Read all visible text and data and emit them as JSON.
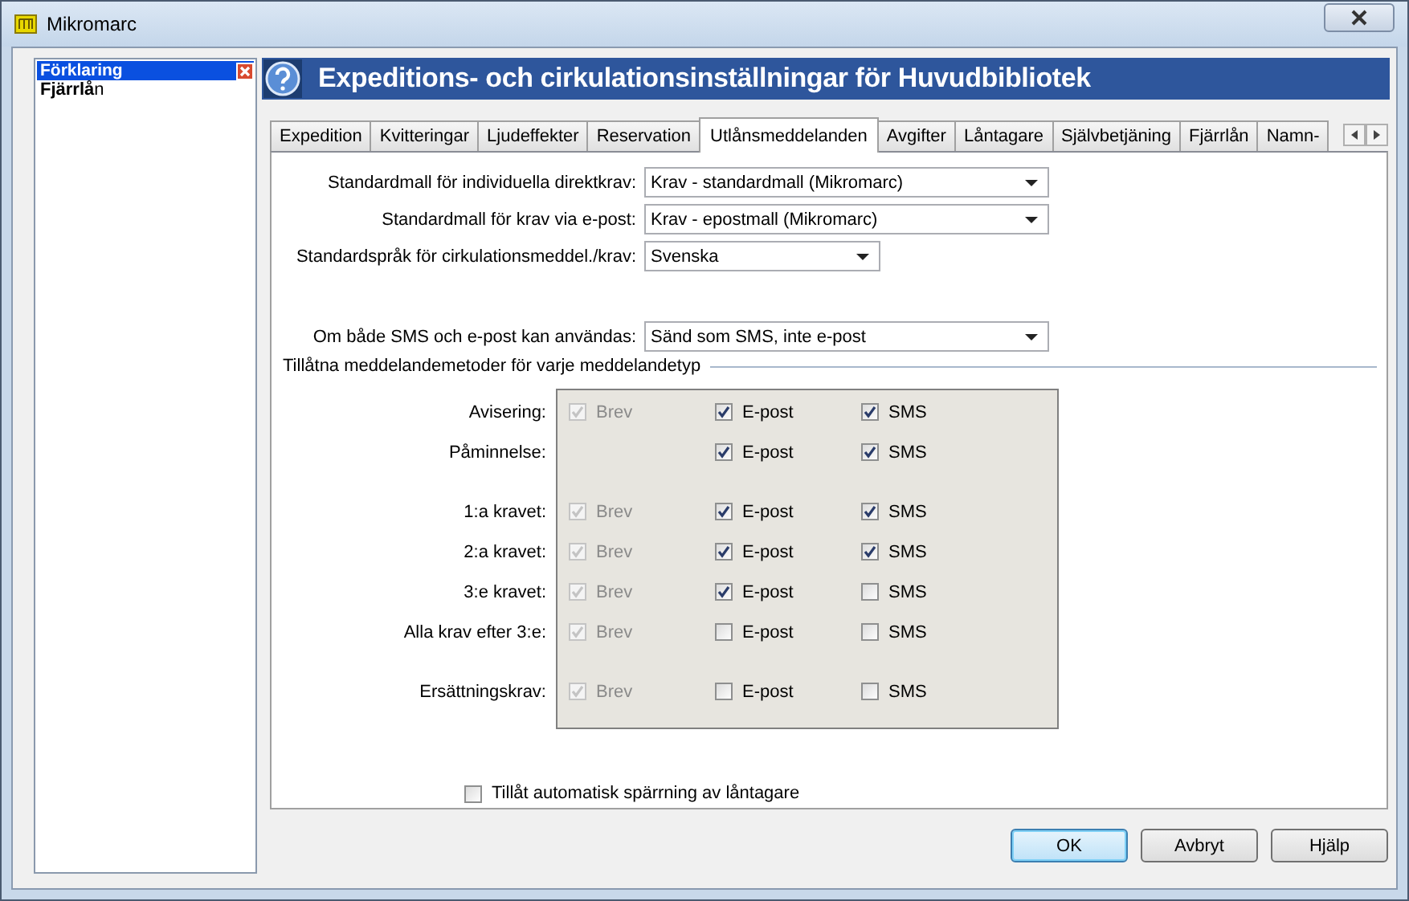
{
  "window": {
    "title": "Mikromarc"
  },
  "side_panel": {
    "title": "Förklaring",
    "items": [
      "**Fjärrlå**n"
    ]
  },
  "header": {
    "title": "Expeditions- och cirkulationsinställningar för Huvudbibliotek"
  },
  "tabs": [
    {
      "label": "Expedition",
      "selected": false
    },
    {
      "label": "Kvitteringar",
      "selected": false
    },
    {
      "label": "Ljudeffekter",
      "selected": false
    },
    {
      "label": "Reservation",
      "selected": false
    },
    {
      "label": "Utlånsmeddelanden",
      "selected": true
    },
    {
      "label": "Avgifter",
      "selected": false
    },
    {
      "label": "Låntagare",
      "selected": false
    },
    {
      "label": "Självbetjäning",
      "selected": false
    },
    {
      "label": "Fjärrlån",
      "selected": false
    },
    {
      "label": "Namn-",
      "selected": false
    }
  ],
  "selects": [
    {
      "label": "Standardmall för individuella direktkrav:",
      "value": "Krav - standardmall (Mikromarc)",
      "kind": "wide"
    },
    {
      "label": "Standardmall för krav via e-post:",
      "value": "Krav - epostmall (Mikromarc)",
      "kind": "wide"
    },
    {
      "label": "Standardspråk för cirkulationsmeddel./krav:",
      "value": "Svenska",
      "kind": "narrow"
    },
    {
      "label": "Om både SMS och e-post kan användas:",
      "value": "Sänd som SMS, inte e-post",
      "kind": "wide",
      "spaced": true
    }
  ],
  "methods_section": {
    "title": "Tillåtna meddelandemetoder för varje meddelandetyp",
    "groups": [
      {
        "rows": [
          {
            "label": "Avisering:",
            "brev": {
              "label": "Brev",
              "checked": true,
              "disabled": true
            },
            "epost": {
              "label": "E-post",
              "checked": true,
              "disabled": false
            },
            "sms": {
              "label": "SMS",
              "checked": true,
              "disabled": false
            }
          },
          {
            "label": "Påminnelse:",
            "epost": {
              "label": "E-post",
              "checked": true,
              "disabled": false
            },
            "sms": {
              "label": "SMS",
              "checked": true,
              "disabled": false
            }
          }
        ]
      },
      {
        "rows": [
          {
            "label": "1:a kravet:",
            "brev": {
              "label": "Brev",
              "checked": true,
              "disabled": true
            },
            "epost": {
              "label": "E-post",
              "checked": true,
              "disabled": false
            },
            "sms": {
              "label": "SMS",
              "checked": true,
              "disabled": false
            }
          },
          {
            "label": "2:a kravet:",
            "brev": {
              "label": "Brev",
              "checked": true,
              "disabled": true
            },
            "epost": {
              "label": "E-post",
              "checked": true,
              "disabled": false
            },
            "sms": {
              "label": "SMS",
              "checked": true,
              "disabled": false
            }
          },
          {
            "label": "3:e kravet:",
            "brev": {
              "label": "Brev",
              "checked": true,
              "disabled": true
            },
            "epost": {
              "label": "E-post",
              "checked": true,
              "disabled": false
            },
            "sms": {
              "label": "SMS",
              "checked": false,
              "disabled": false
            }
          },
          {
            "label": "Alla krav efter 3:e:",
            "brev": {
              "label": "Brev",
              "checked": true,
              "disabled": true
            },
            "epost": {
              "label": "E-post",
              "checked": false,
              "disabled": false
            },
            "sms": {
              "label": "SMS",
              "checked": false,
              "disabled": false
            }
          }
        ]
      },
      {
        "rows": [
          {
            "label": "Ersättningskrav:",
            "brev": {
              "label": "Brev",
              "checked": true,
              "disabled": true
            },
            "epost": {
              "label": "E-post",
              "checked": false,
              "disabled": false
            },
            "sms": {
              "label": "SMS",
              "checked": false,
              "disabled": false
            }
          }
        ]
      }
    ]
  },
  "auto_block": {
    "label": "Tillåt automatisk spärrning av låntagare",
    "checked": false
  },
  "buttons": [
    {
      "label": "OK",
      "kind": "default"
    },
    {
      "label": "Avbryt",
      "kind": "normal"
    },
    {
      "label": "Hjälp",
      "kind": "normal"
    }
  ]
}
